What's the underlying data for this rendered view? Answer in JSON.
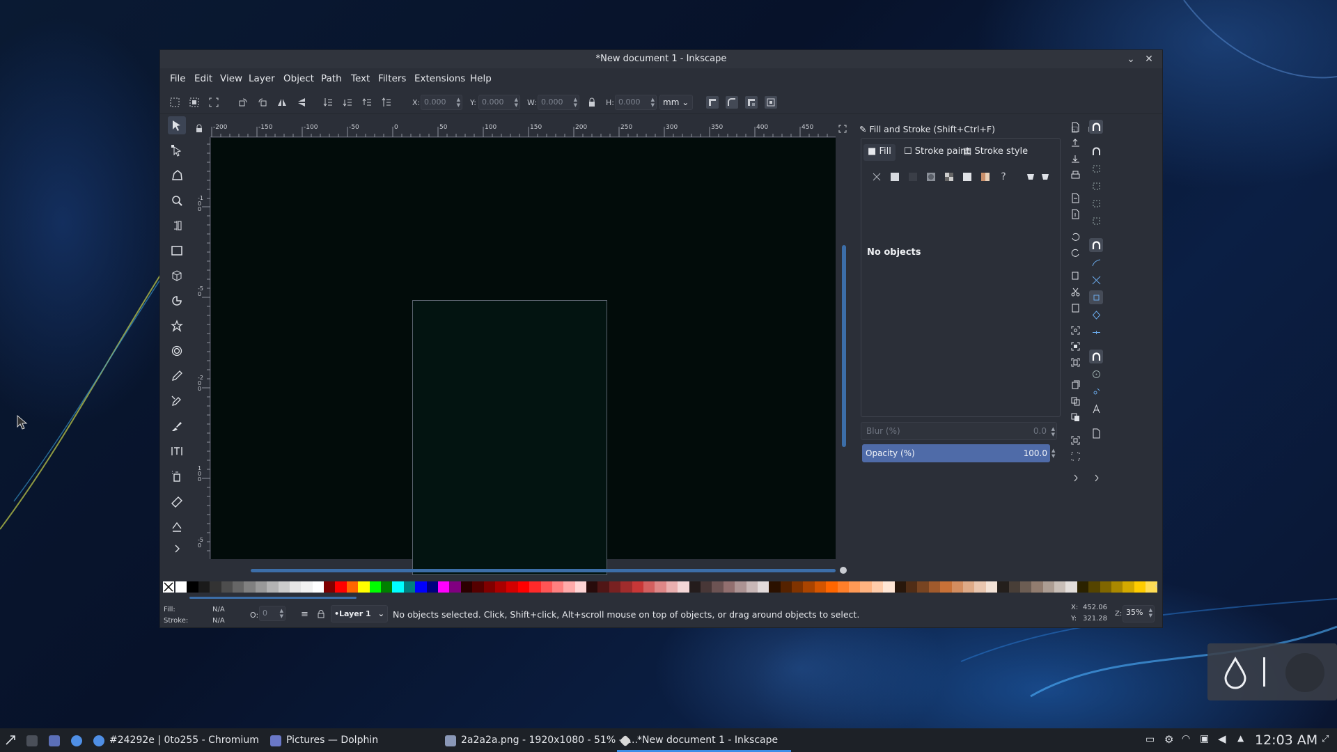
{
  "window": {
    "title": "*New document 1 - Inkscape"
  },
  "menu": [
    "File",
    "Edit",
    "View",
    "Layer",
    "Object",
    "Path",
    "Text",
    "Filters",
    "Extensions",
    "Help"
  ],
  "toolbar": {
    "x_label": "X:",
    "x_value": "0.000",
    "y_label": "Y:",
    "y_value": "0.000",
    "w_label": "W:",
    "w_value": "0.000",
    "h_label": "H:",
    "h_value": "0.000",
    "unit": "mm"
  },
  "ruler": {
    "h_ticks": [
      "-200",
      "-150",
      "-100",
      "-50",
      "0",
      "50",
      "100",
      "150",
      "200",
      "250",
      "300",
      "350",
      "400",
      "450"
    ],
    "v_ticks": [
      "-1",
      "0",
      "0",
      "-5",
      "0",
      "-2",
      "0",
      "0",
      "1",
      "0",
      "0",
      "-5",
      "0"
    ]
  },
  "tools": [
    "select",
    "node",
    "tweak",
    "zoom",
    "measure",
    "rectangle",
    "3d-box",
    "ellipse",
    "star",
    "spiral",
    "pencil",
    "pen",
    "calligraphy",
    "text",
    "spray",
    "eraser",
    "paint-bucket",
    "more"
  ],
  "dock": {
    "title": "Fill and Stroke (Shift+Ctrl+F)",
    "tabs": [
      "Fill",
      "Stroke paint",
      "Stroke style"
    ],
    "no_objects": "No objects",
    "blur_label": "Blur (%)",
    "blur_value": "0.0",
    "opacity_label": "Opacity (%)",
    "opacity_value": "100.0",
    "opacity_fraction": 1.0
  },
  "palette": [
    "#ffffff",
    "#000000",
    "#1a1a1a",
    "#333333",
    "#4d4d4d",
    "#666666",
    "#808080",
    "#999999",
    "#b3b3b3",
    "#cccccc",
    "#e6e6e6",
    "#f2f2f2",
    "#ffffff",
    "#800000",
    "#ff0000",
    "#ff6600",
    "#ffff00",
    "#00ff00",
    "#008000",
    "#00ffff",
    "#008080",
    "#0000ff",
    "#000080",
    "#ff00ff",
    "#800080",
    "#2b0000",
    "#550000",
    "#800000",
    "#aa0000",
    "#d40000",
    "#ff0000",
    "#ff2a2a",
    "#ff5555",
    "#ff8080",
    "#ffaaaa",
    "#ffd5d5",
    "#280b0b",
    "#501616",
    "#782121",
    "#a02c2c",
    "#c83737",
    "#d35f5f",
    "#de8787",
    "#e9afaf",
    "#f4d7d7",
    "#241c1c",
    "#483737",
    "#6c5353",
    "#916f6f",
    "#ac9393",
    "#c8b7b7",
    "#e3dbdb",
    "#2b1100",
    "#552200",
    "#803300",
    "#aa4400",
    "#d45500",
    "#ff6600",
    "#ff7f2a",
    "#ff9955",
    "#ffb380",
    "#ffccaa",
    "#ffe6d5",
    "#28170b",
    "#502d16",
    "#784421",
    "#a05a2c",
    "#c87137",
    "#d38d5f",
    "#deaa87",
    "#e9c6af",
    "#f4e3d7",
    "#241f1c",
    "#483e37",
    "#6c5d53",
    "#917c6f",
    "#ac9d93",
    "#c8beb7",
    "#e3dedb",
    "#2b2200",
    "#554400",
    "#806600",
    "#aa8800",
    "#d4aa00",
    "#ffcc00",
    "#ffdd55"
  ],
  "status": {
    "fill_label": "Fill:",
    "fill_value": "N/A",
    "stroke_label": "Stroke:",
    "stroke_value": "N/A",
    "o_label": "O:",
    "o_value": "0",
    "layer": "•Layer 1",
    "message": "No objects selected. Click, Shift+click, Alt+scroll mouse on top of objects, or drag around objects to select.",
    "x_label": "X:",
    "x_value": "452.06",
    "y_label": "Y:",
    "y_value": "321.28",
    "zoom_label": "Z:",
    "zoom_value": "35%"
  },
  "taskbar": {
    "items": [
      "#24292e | 0to255 - Chromium",
      "Pictures — Dolphin",
      "2a2a2a.png - 1920x1080 - 51% —...",
      "*New document 1 - Inkscape"
    ],
    "clock": "12:03 AM"
  }
}
